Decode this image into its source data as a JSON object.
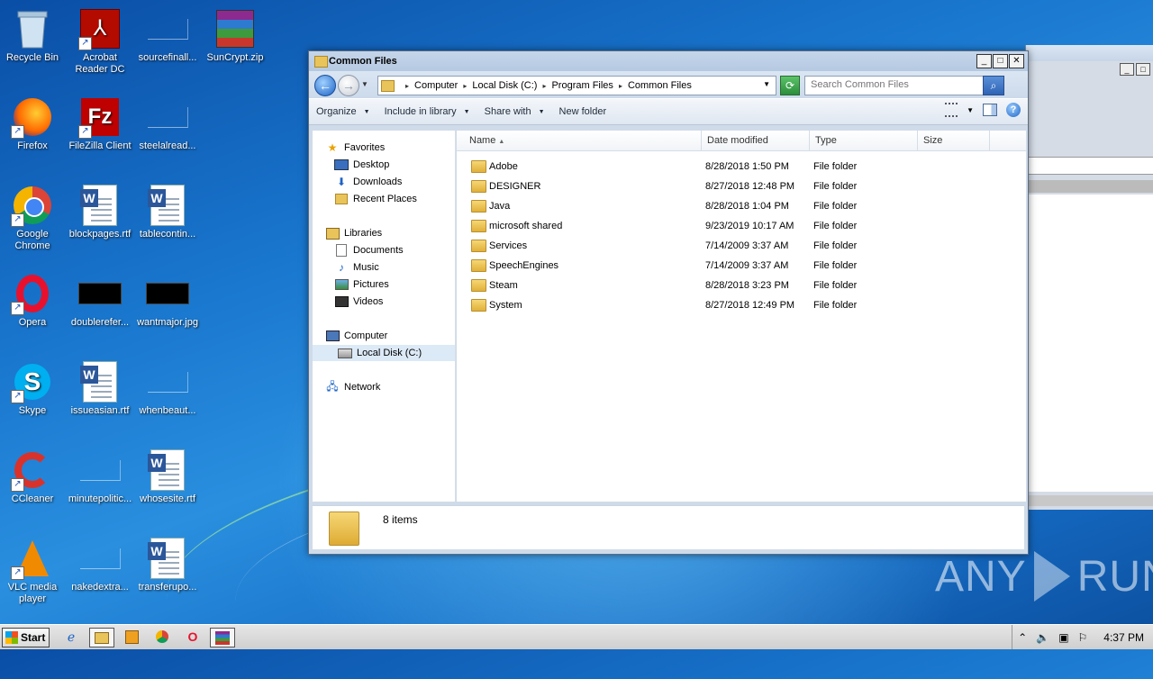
{
  "desktop": {
    "icons": [
      {
        "label": "Recycle Bin"
      },
      {
        "label": "Acrobat Reader DC"
      },
      {
        "label": "sourcefinall..."
      },
      {
        "label": "SunCrypt.zip"
      },
      {
        "label": "Firefox"
      },
      {
        "label": "FileZilla Client"
      },
      {
        "label": "steelalread..."
      },
      {
        "label": "Google Chrome"
      },
      {
        "label": "blockpages.rtf"
      },
      {
        "label": "tablecontin..."
      },
      {
        "label": "Opera"
      },
      {
        "label": "doublerefer..."
      },
      {
        "label": "wantmajor.jpg"
      },
      {
        "label": "Skype"
      },
      {
        "label": "issueasian.rtf"
      },
      {
        "label": "whenbeaut..."
      },
      {
        "label": "CCleaner"
      },
      {
        "label": "minutepolitic..."
      },
      {
        "label": "whosesite.rtf"
      },
      {
        "label": "VLC media player"
      },
      {
        "label": "nakedextra..."
      },
      {
        "label": "transferupo..."
      }
    ]
  },
  "window": {
    "title": "Common Files",
    "min_label": "_",
    "max_label": "□",
    "close_label": "✕",
    "breadcrumbs": [
      "Computer",
      "Local Disk (C:)",
      "Program Files",
      "Common Files"
    ],
    "search_placeholder": "Search Common Files",
    "toolbar": {
      "organize": "Organize",
      "include": "Include in library",
      "share": "Share with",
      "new_folder": "New folder"
    },
    "nav": {
      "favorites": "Favorites",
      "desktop": "Desktop",
      "downloads": "Downloads",
      "recent": "Recent Places",
      "libraries": "Libraries",
      "documents": "Documents",
      "music": "Music",
      "pictures": "Pictures",
      "videos": "Videos",
      "computer": "Computer",
      "local_disk": "Local Disk (C:)",
      "network": "Network"
    },
    "columns": {
      "name": "Name",
      "date": "Date modified",
      "type": "Type",
      "size": "Size"
    },
    "files": [
      {
        "name": "Adobe",
        "date": "8/28/2018 1:50 PM",
        "type": "File folder"
      },
      {
        "name": "DESIGNER",
        "date": "8/27/2018 12:48 PM",
        "type": "File folder"
      },
      {
        "name": "Java",
        "date": "8/28/2018 1:04 PM",
        "type": "File folder"
      },
      {
        "name": "microsoft shared",
        "date": "9/23/2019 10:17 AM",
        "type": "File folder"
      },
      {
        "name": "Services",
        "date": "7/14/2009 3:37 AM",
        "type": "File folder"
      },
      {
        "name": "SpeechEngines",
        "date": "7/14/2009 3:37 AM",
        "type": "File folder"
      },
      {
        "name": "Steam",
        "date": "8/28/2018 3:23 PM",
        "type": "File folder"
      },
      {
        "name": "System",
        "date": "8/27/2018 12:49 PM",
        "type": "File folder"
      }
    ],
    "status_count": "8 items"
  },
  "watermark": {
    "left": "ANY",
    "right": "RUN"
  },
  "taskbar": {
    "start_label": "Start",
    "clock": "4:37 PM"
  }
}
